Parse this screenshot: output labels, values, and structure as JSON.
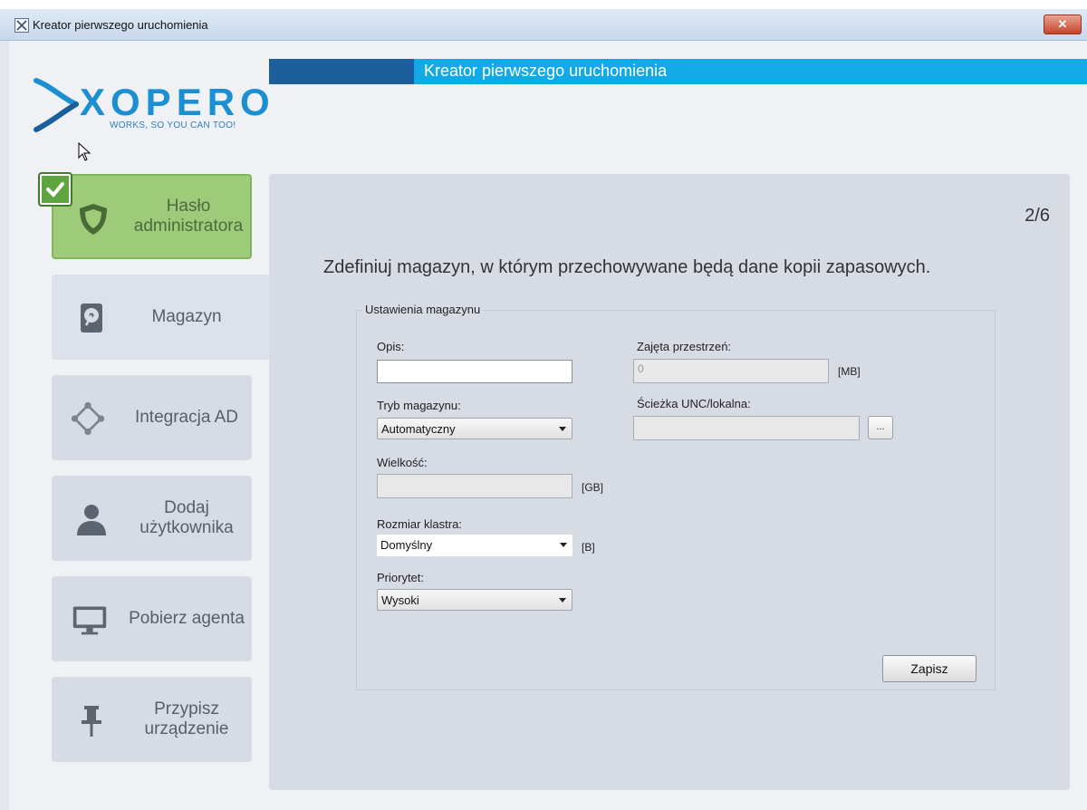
{
  "window": {
    "title": "Kreator pierwszego uruchomienia",
    "close_label": "✕"
  },
  "header": {
    "banner_title": "Kreator pierwszego uruchomienia"
  },
  "logo": {
    "word": "XOPERO",
    "tagline": "WORKS, SO YOU CAN TOO!"
  },
  "colors": {
    "accent": "#13a9e6",
    "banner_dark": "#1a5f9c",
    "done_green": "#9dcb79"
  },
  "sidebar": {
    "items": [
      {
        "label": "Hasło administratora",
        "icon": "shield-icon",
        "state": "done"
      },
      {
        "label": "Magazyn",
        "icon": "drive-icon",
        "state": "current"
      },
      {
        "label": "Integracja AD",
        "icon": "network-icon",
        "state": "pending"
      },
      {
        "label": "Dodaj użytkownika",
        "icon": "user-icon",
        "state": "pending"
      },
      {
        "label": "Pobierz agenta",
        "icon": "monitor-icon",
        "state": "pending"
      },
      {
        "label": "Przypisz urządzenie",
        "icon": "pin-icon",
        "state": "pending"
      }
    ]
  },
  "main": {
    "step": "2/6",
    "instruction": "Zdefiniuj magazyn, w którym przechowywane będą dane kopii zapasowych.",
    "group_title": "Ustawienia magazynu",
    "opis_label": "Opis:",
    "opis_value": "",
    "tryb_label": "Tryb magazynu:",
    "tryb_value": "Automatyczny",
    "wielkosc_label": "Wielkość:",
    "wielkosc_value": "",
    "wielkosc_unit": "[GB]",
    "klaster_label": "Rozmiar klastra:",
    "klaster_value": "Domyślny",
    "klaster_unit": "[B]",
    "priorytet_label": "Priorytet:",
    "priorytet_value": "Wysoki",
    "zajeta_label": "Zajęta przestrzeń:",
    "zajeta_value": "0",
    "zajeta_unit": "[MB]",
    "sciezka_label": "Ścieżka UNC/lokalna:",
    "sciezka_value": "",
    "browse_label": "...",
    "save_label": "Zapisz"
  }
}
